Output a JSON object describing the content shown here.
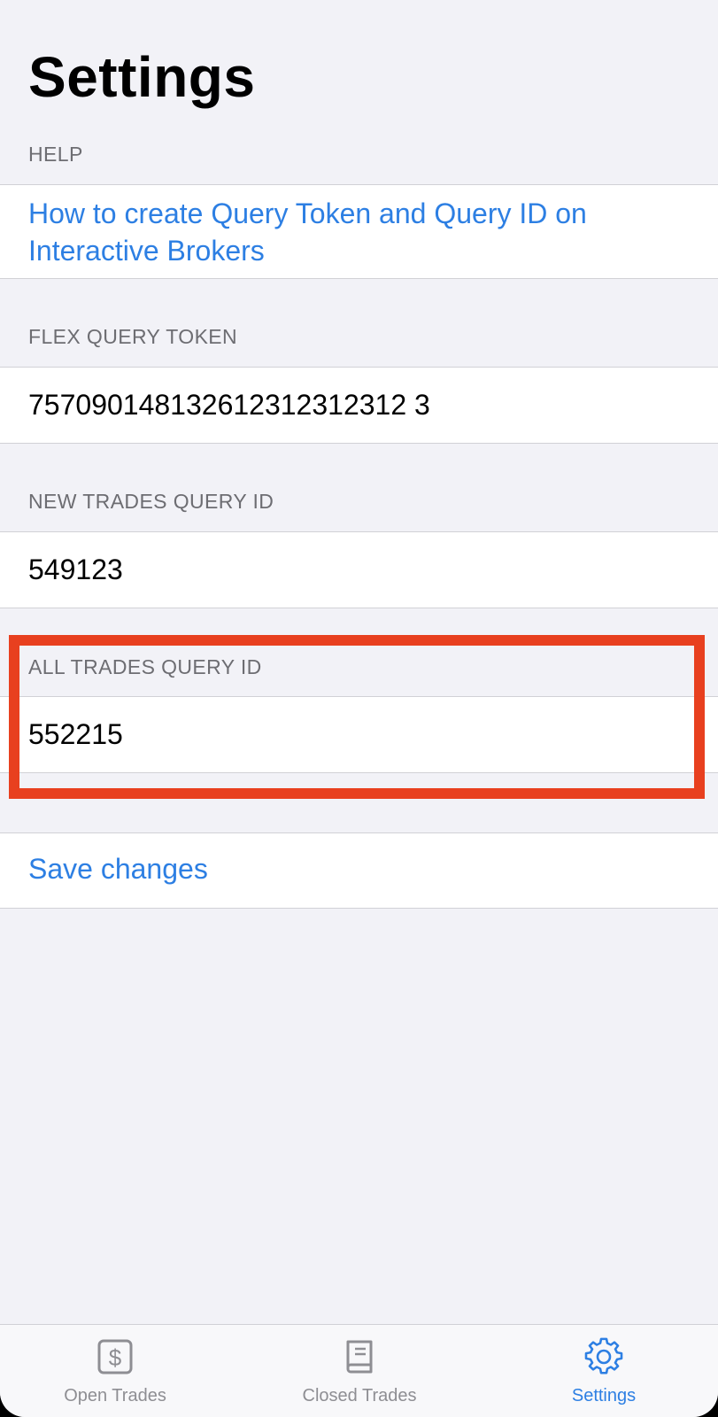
{
  "page": {
    "title": "Settings"
  },
  "help": {
    "header": "HELP",
    "link_text": "How to create Query Token and Query ID on Interactive Brokers"
  },
  "flex_query_token": {
    "header": "FLEX QUERY TOKEN",
    "value": "757090148132612312312312 3"
  },
  "new_trades_query_id": {
    "header": "NEW TRADES QUERY ID",
    "value": "549123"
  },
  "all_trades_query_id": {
    "header": "ALL TRADES QUERY ID",
    "value": "552215"
  },
  "save": {
    "label": "Save changes"
  },
  "tabs": [
    {
      "label": "Open Trades",
      "icon": "dollar-square-icon",
      "active": false
    },
    {
      "label": "Closed Trades",
      "icon": "book-icon",
      "active": false
    },
    {
      "label": "Settings",
      "icon": "gear-icon",
      "active": true
    }
  ],
  "colors": {
    "background": "#f2f2f7",
    "link": "#2d7fe3",
    "header_text": "#6d6d72",
    "highlight": "#e8401f",
    "tab_inactive": "#8e8e93",
    "tab_active": "#2d7fe3"
  }
}
